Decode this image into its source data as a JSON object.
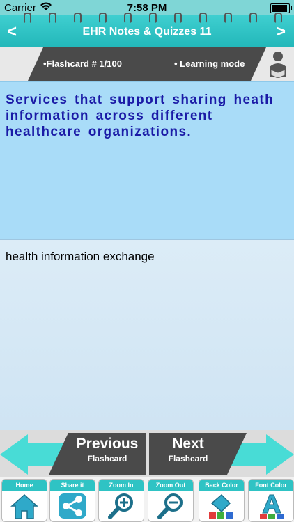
{
  "status": {
    "carrier": "Carrier",
    "time": "7:58 PM"
  },
  "nav": {
    "title": "EHR Notes & Quizzes 11",
    "back": "<",
    "forward": ">"
  },
  "info": {
    "flashcard": "•Flashcard # 1/100",
    "mode": "• Learning mode"
  },
  "card": {
    "question": "Services that support sharing heath information across different healthcare organizations.",
    "answer": "health information exchange"
  },
  "buttons": {
    "previous": {
      "big": "Previous",
      "small": "Flashcard"
    },
    "next": {
      "big": "Next",
      "small": "Flashcard"
    }
  },
  "toolbar": [
    {
      "label": "Home",
      "icon": "home-icon"
    },
    {
      "label": "Share it",
      "icon": "share-icon"
    },
    {
      "label": "Zoom In",
      "icon": "zoom-in-icon"
    },
    {
      "label": "Zoom Out",
      "icon": "zoom-out-icon"
    },
    {
      "label": "Back Color",
      "icon": "back-color-icon"
    },
    {
      "label": "Font Color",
      "icon": "font-color-icon"
    }
  ],
  "colors": {
    "accent": "#2fc3c4",
    "question_bg": "#a9dcf8",
    "question_text": "#1a1aa6",
    "dark": "#4a4a4a"
  }
}
